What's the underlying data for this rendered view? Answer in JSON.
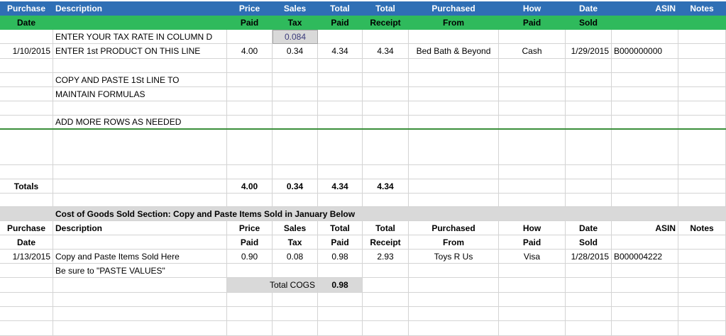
{
  "headers_row1": [
    "Purchase",
    "Description",
    "Price",
    "Sales",
    "Total",
    "Total",
    "Purchased",
    "How",
    "Date",
    "ASIN",
    "Notes"
  ],
  "headers_row2": [
    "Date",
    "",
    "Paid",
    "Tax",
    "Paid",
    "Receipt",
    "From",
    "Paid",
    "Sold",
    "",
    ""
  ],
  "instructions": {
    "tax_rate": "ENTER YOUR TAX RATE IN COLUMN D",
    "tax_rate_value": "0.084",
    "copy_line1": "COPY AND PASTE 1St LINE TO",
    "copy_line2": "MAINTAIN FORMULAS",
    "add_rows": "ADD MORE ROWS AS NEEDED"
  },
  "first_product": {
    "date": "1/10/2015",
    "description": "ENTER 1st PRODUCT ON THIS LINE",
    "price": "4.00",
    "tax": "0.34",
    "total_paid": "4.34",
    "total_receipt": "4.34",
    "from": "Bed Bath & Beyond",
    "how_paid": "Cash",
    "date_sold": "1/29/2015",
    "asin": "B000000000"
  },
  "totals": {
    "label": "Totals",
    "price": "4.00",
    "tax": "0.34",
    "total_paid": "4.34",
    "total_receipt": "4.34"
  },
  "cogs": {
    "section_title": "Cost of Goods Sold Section: Copy and Paste Items Sold in January Below",
    "headers_row1": [
      "Purchase",
      "Description",
      "Price",
      "Sales",
      "Total",
      "Total",
      "Purchased",
      "How",
      "Date",
      "ASIN",
      "Notes"
    ],
    "headers_row2": [
      "Date",
      "",
      "Paid",
      "Tax",
      "Paid",
      "Receipt",
      "From",
      "Paid",
      "Sold",
      "",
      ""
    ],
    "item": {
      "date": "1/13/2015",
      "description": "Copy and Paste Items Sold Here",
      "price": "0.90",
      "tax": "0.08",
      "total_paid": "0.98",
      "total_receipt": "2.93",
      "from": "Toys R Us",
      "how_paid": "Visa",
      "date_sold": "1/28/2015",
      "asin": "B000004222"
    },
    "paste_note": "Be sure to \"PASTE VALUES\"",
    "total_label": "Total COGS",
    "total_value": "0.98"
  }
}
